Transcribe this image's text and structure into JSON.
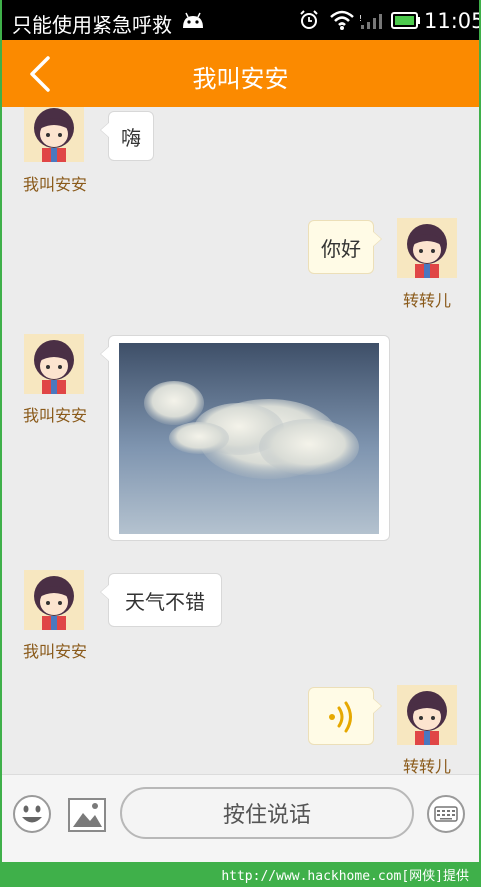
{
  "status_bar": {
    "carrier_text": "只能使用紧急呼救",
    "time": "11:05",
    "icons": [
      "android-icon",
      "alarm-icon",
      "wifi-icon",
      "signal-icon",
      "battery-icon"
    ]
  },
  "header": {
    "title": "我叫安安",
    "back_icon": "back-arrow-icon",
    "background": "#fb8a00"
  },
  "messages": [
    {
      "sender": "我叫安安",
      "side": "left",
      "type": "text",
      "text": "嗨"
    },
    {
      "sender": "转转儿",
      "side": "right",
      "type": "text",
      "text": "你好"
    },
    {
      "sender": "我叫安安",
      "side": "left",
      "type": "image",
      "description": "sky-photo"
    },
    {
      "sender": "我叫安安",
      "side": "left",
      "type": "text",
      "text": "天气不错"
    },
    {
      "sender": "转转儿",
      "side": "right",
      "type": "voice",
      "icon": "voice-wave-icon"
    }
  ],
  "input_bar": {
    "emoji_icon": "emoji-icon",
    "image_icon": "image-icon",
    "talk_label": "按住说话",
    "keyboard_icon": "keyboard-icon"
  },
  "watermark": "http://www.hackhome.com[网侠]提供"
}
